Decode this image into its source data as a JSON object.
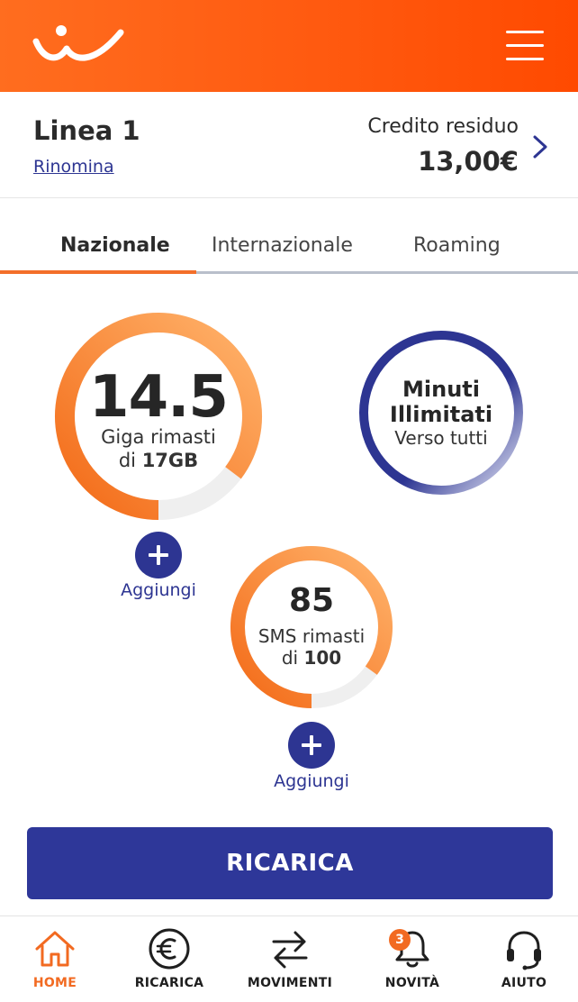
{
  "header": {
    "logo_icon": "wind-tre-wave-icon",
    "menu_icon": "hamburger-menu-icon",
    "background_colors": [
      "#ff6d1f",
      "#ff4a00"
    ]
  },
  "line": {
    "title": "Linea 1",
    "rename_label": "Rinomina",
    "credit_label": "Credito residuo",
    "credit_value": "13,00€"
  },
  "tabs": [
    {
      "label": "Nazionale",
      "active": true
    },
    {
      "label": "Internazionale",
      "active": false
    },
    {
      "label": "Roaming",
      "active": false
    }
  ],
  "data_counter": {
    "value": "14.5",
    "label": "Giga rimasti",
    "of_prefix": "di",
    "total": "17GB",
    "remaining_fraction": 0.853,
    "add_label": "Aggiungi"
  },
  "minutes": {
    "title_line1": "Minuti",
    "title_line2": "Illimitati",
    "subtitle": "Verso tutti"
  },
  "sms_counter": {
    "value": "85",
    "label": "SMS rimasti",
    "of_prefix": "di",
    "total": "100",
    "remaining_fraction": 0.85,
    "add_label": "Aggiungi"
  },
  "recharge_button": "RICARICA",
  "bottom_nav": [
    {
      "label": "HOME",
      "icon": "home-icon",
      "active": true
    },
    {
      "label": "RICARICA",
      "icon": "euro-icon",
      "active": false
    },
    {
      "label": "MOVIMENTI",
      "icon": "transfer-arrows-icon",
      "active": false
    },
    {
      "label": "NOVITÀ",
      "icon": "bell-icon",
      "active": false,
      "badge": "3"
    },
    {
      "label": "AIUTO",
      "icon": "headset-icon",
      "active": false
    }
  ],
  "colors": {
    "accent_orange": "#f26a21",
    "brand_blue": "#2d3592",
    "track_gray": "#efefef"
  }
}
